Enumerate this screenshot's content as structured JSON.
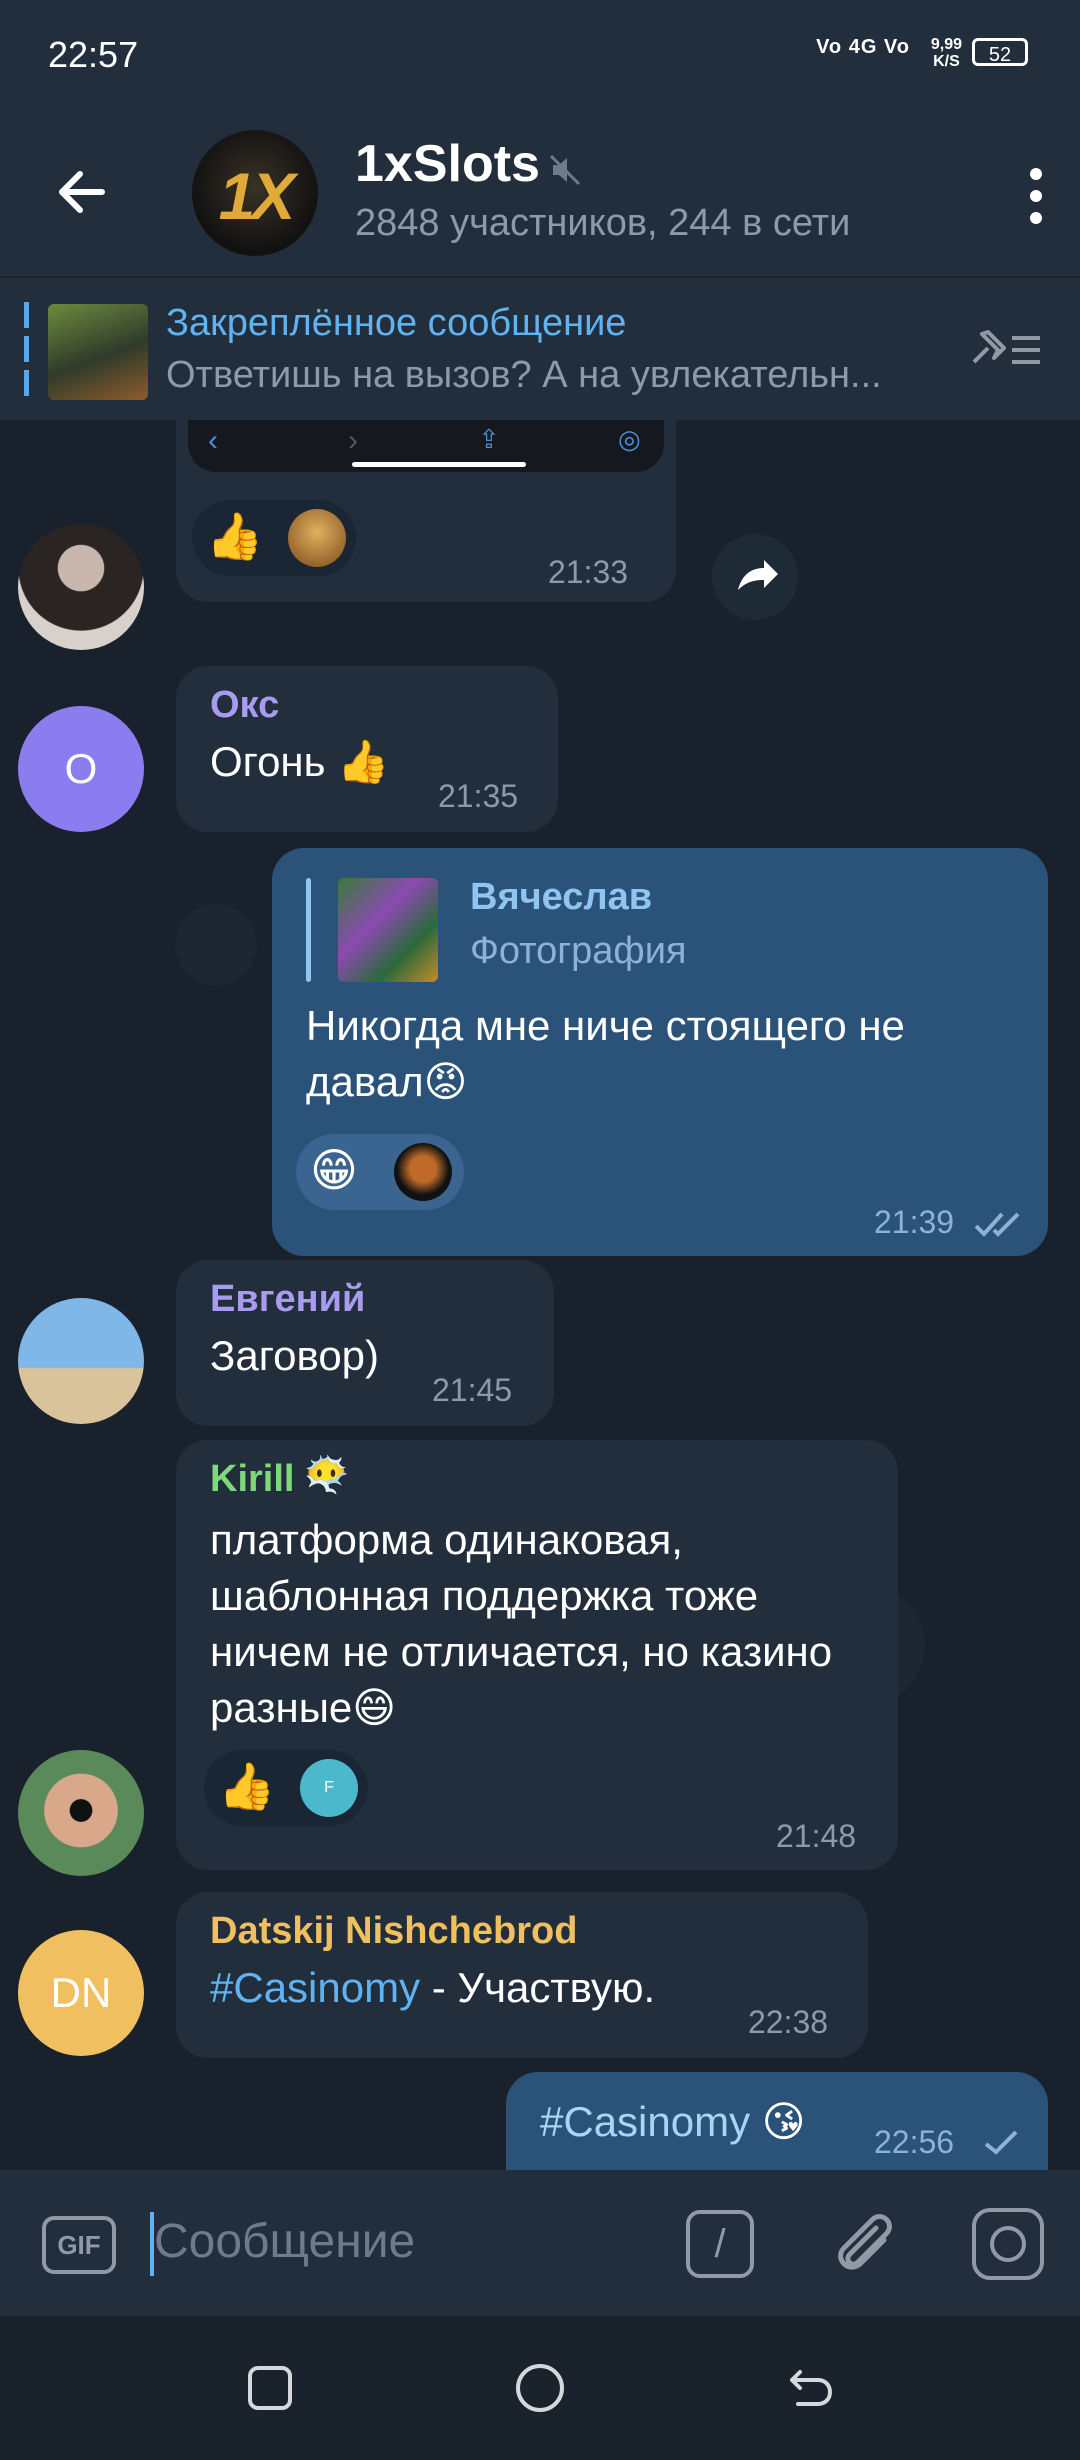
{
  "status": {
    "time": "22:57",
    "network": "Vo 4G Vo",
    "speed_value": "9,99",
    "speed_unit": "K/S",
    "battery": "52"
  },
  "header": {
    "title": "1xSlots",
    "subtitle": "2848 участников, 244 в сети",
    "avatar_text": "1X"
  },
  "pinned": {
    "title": "Закреплённое сообщение",
    "text": "Ответишь на вызов?  А на увлекательн..."
  },
  "messages": [
    {
      "time": "21:33",
      "reactions": [
        "👍"
      ]
    },
    {
      "sender": "Окс",
      "avatar": "О",
      "text": "Огонь 👍",
      "time": "21:35"
    },
    {
      "reply_sender": "Вячеслав",
      "reply_text": "Фотография",
      "text": "Никогда мне ниче стоящего не давал😡",
      "time": "21:39",
      "reactions": [
        "😁"
      ]
    },
    {
      "sender": "Евгений",
      "text": "Заговор)",
      "time": "21:45"
    },
    {
      "sender": "Kirill",
      "sender_emoji": "😶‍🌫️",
      "text": "платформа одинаковая, шаблонная поддержка тоже ничем не отличается, но казино разные😄",
      "time": "21:48",
      "reactions": [
        "👍"
      ],
      "reaction_avatar": "F"
    },
    {
      "sender": "Datskij Nishchebrod",
      "avatar": "DN",
      "hashtag": "#Casinomy",
      "text": " - Участвую.",
      "time": "22:38"
    },
    {
      "hashtag": "#Casinomy",
      "text": " 😘",
      "time": "22:56"
    }
  ],
  "input": {
    "placeholder": "Сообщение",
    "gif_label": "GIF",
    "command_label": "/"
  },
  "colors": {
    "accent": "#5fb3f2",
    "outgoing_bubble": "#2b5278",
    "incoming_bubble": "#222e3b",
    "name_oks": "#a99cf0",
    "name_kirill": "#7ed97b",
    "name_dn": "#f0c060"
  }
}
